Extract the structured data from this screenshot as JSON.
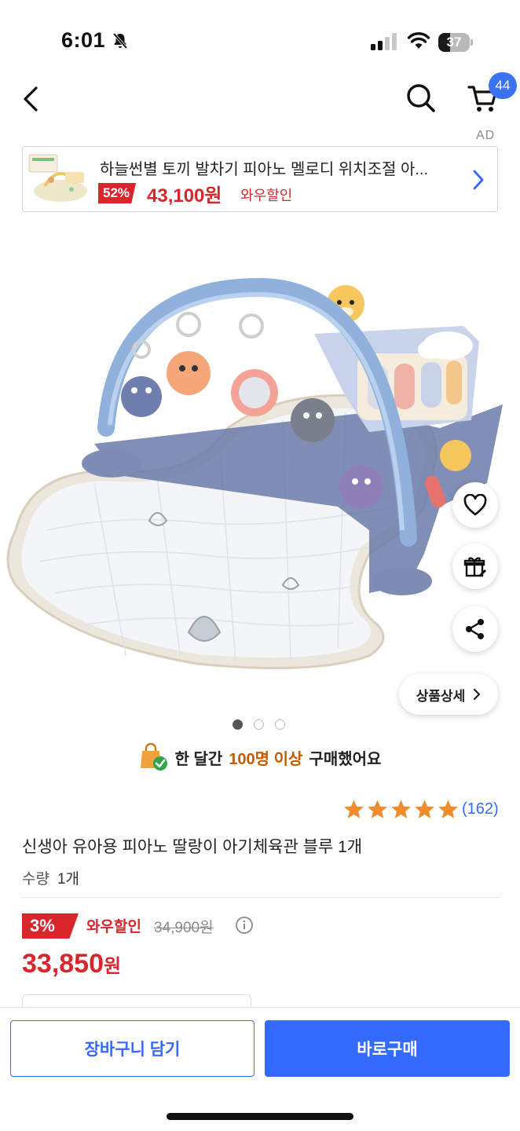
{
  "status_bar": {
    "time": "6:01",
    "battery_level": "37",
    "battery_fraction": 0.37
  },
  "nav": {
    "cart_badge": "44"
  },
  "ad": {
    "label": "AD",
    "title": "하늘썬별 토끼 발차기 피아노 멜로디 위치조절 아...",
    "discount": "52%",
    "price": "43,100원",
    "wow_label": "와우할인"
  },
  "gallery": {
    "detail_button": "상품상세",
    "total_images": 3,
    "active_index": 0
  },
  "social_proof": {
    "prefix": "한 달간",
    "highlight": "100명 이상",
    "suffix": "구매했어요"
  },
  "rating": {
    "stars": 5,
    "review_count": "(162)"
  },
  "product": {
    "title": "신생아 유아용 피아노 딸랑이 아기체육관 블루 1개",
    "quantity_label": "수량",
    "quantity_value": "1개"
  },
  "price": {
    "discount": "3%",
    "wow_label": "와우할인",
    "original": "34,900원",
    "sale_amount": "33,850",
    "sale_unit": "원"
  },
  "bottom_bar": {
    "cart_button": "장바구니 담기",
    "buy_button": "바로구매"
  },
  "colors": {
    "accent_blue": "#346aff",
    "sale_red": "#d7262c",
    "highlight_orange": "#c55a00",
    "star_orange": "#f28b2c"
  }
}
